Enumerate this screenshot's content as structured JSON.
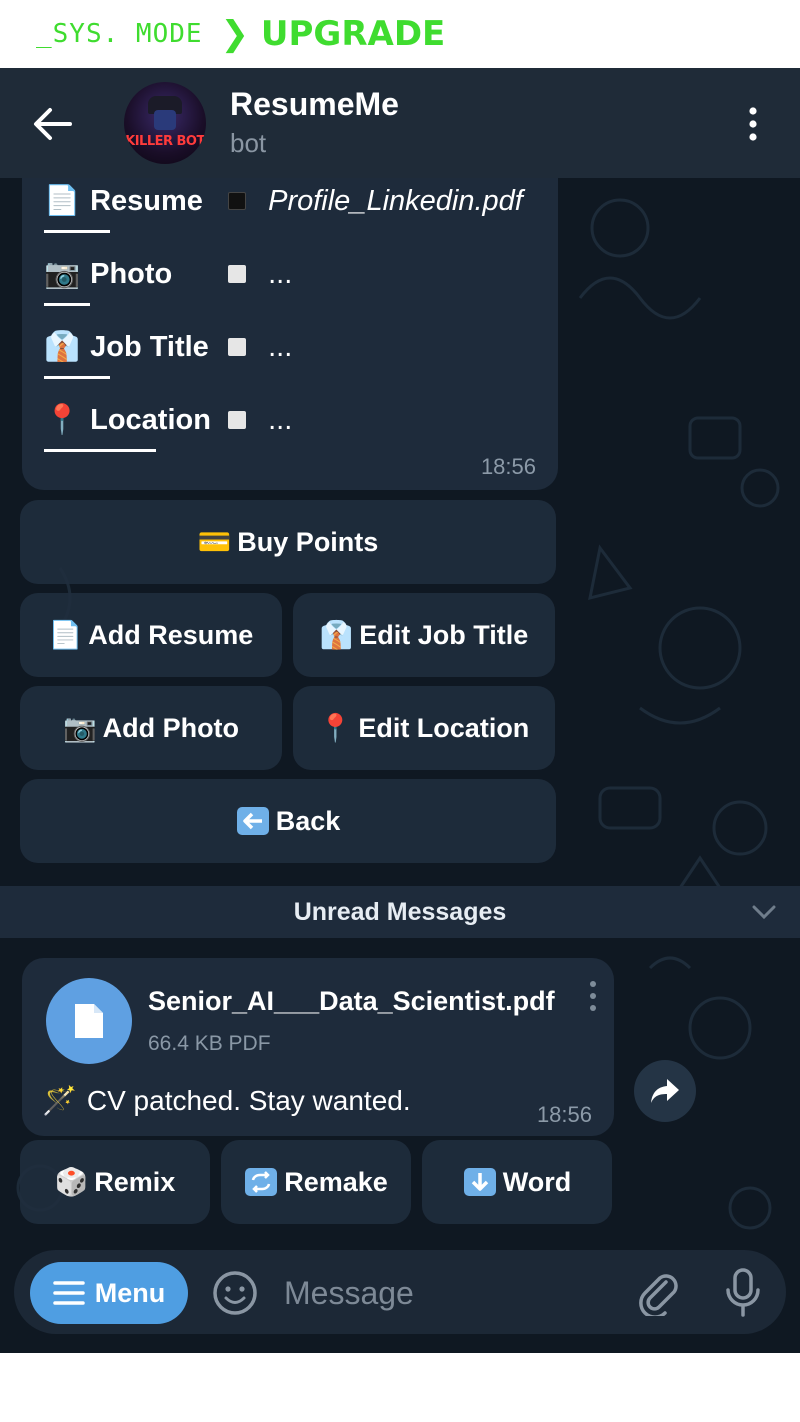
{
  "banner": {
    "sys_mode": "_SYS. MODE",
    "upgrade": "UPGRADE",
    "chevron": "❯",
    "color": "#3fdc2f"
  },
  "header": {
    "title": "ResumeMe",
    "subtitle": "bot",
    "avatar_text": "KILLER BOT",
    "back_icon": "back-arrow-icon",
    "menu_icon": "kebab-menu-icon"
  },
  "profile_message": {
    "rows": [
      {
        "emoji": "📄",
        "label": "Resume",
        "value": "Profile_Linkedin.pdf",
        "status": "black"
      },
      {
        "emoji": "📷",
        "label": "Photo",
        "value": "...",
        "status": "white"
      },
      {
        "emoji": "👔",
        "label": "Job Title",
        "value": "...",
        "status": "white"
      },
      {
        "emoji": "📍",
        "label": "Location",
        "value": "...",
        "status": "white"
      }
    ],
    "time": "18:56"
  },
  "keyboard": {
    "buy_points": "Buy Points",
    "add_resume": "Add Resume",
    "edit_job_title": "Edit Job Title",
    "add_photo": "Add Photo",
    "edit_location": "Edit Location",
    "back": "Back"
  },
  "unread": {
    "label": "Unread Messages"
  },
  "file_message": {
    "file_name": "Senior_AI___Data_Scientist.pdf",
    "file_meta": "66.4 KB PDF",
    "caption": "CV patched. Stay wanted.",
    "caption_emoji": "🪄",
    "time": "18:56"
  },
  "file_actions": {
    "remix": "Remix",
    "remake": "Remake",
    "word": "Word"
  },
  "input_bar": {
    "menu_label": "Menu",
    "placeholder": "Message"
  },
  "colors": {
    "bg": "#0f1822",
    "header": "#1f2b38",
    "bubble": "#1e2b3b",
    "accent": "#4f9ee2"
  }
}
